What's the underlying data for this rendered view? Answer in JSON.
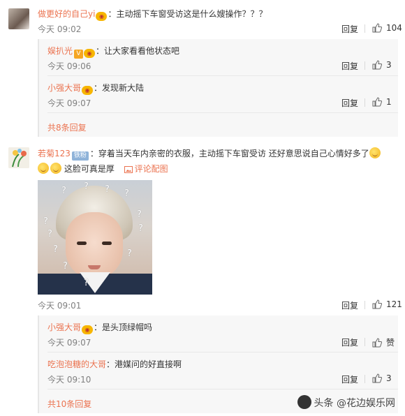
{
  "comments": [
    {
      "user": "做更好的自己yi",
      "text": "：主动摇下车窗受访这是什么嫂操作？？？",
      "time": "今天 09:02",
      "reply_label": "回复",
      "likes": "104",
      "replies": [
        {
          "user": "娱扒光",
          "text": "：让大家看看他状态吧",
          "time": "今天 09:06",
          "reply_label": "回复",
          "likes": "3"
        },
        {
          "user": "小强大哥",
          "text": "：发现新大陆",
          "time": "今天 09:07",
          "reply_label": "回复",
          "likes": "1"
        }
      ],
      "more_label": "共8条回复"
    },
    {
      "user": "若菊123",
      "badge": "铁粉",
      "text": "：穿着当天车内亲密的衣服，主动摇下车窗受访 还好意思说自己心情好多了",
      "text2": "这脸可真是厚",
      "pic_label": "评论配图",
      "time": "今天 09:01",
      "reply_label": "回复",
      "likes": "121",
      "replies": [
        {
          "user": "小强大哥",
          "text": "：是头顶绿帽吗",
          "time": "今天 09:07",
          "reply_label": "回复",
          "likes": "赞"
        },
        {
          "user": "吃泡泡糖的大哥",
          "text": "：港媒问的好直接啊",
          "time": "今天 09:10",
          "reply_label": "回复",
          "likes": "3"
        }
      ],
      "more_label": "共10条回复"
    }
  ],
  "photo_marks": "? ? ? ? ? ? ? ? ? ? ? ?",
  "watermark": "头条 @花边娱乐网",
  "colors": {
    "username": "#eb7350",
    "meta": "#808080",
    "sub_bg": "#f7f7f7"
  }
}
